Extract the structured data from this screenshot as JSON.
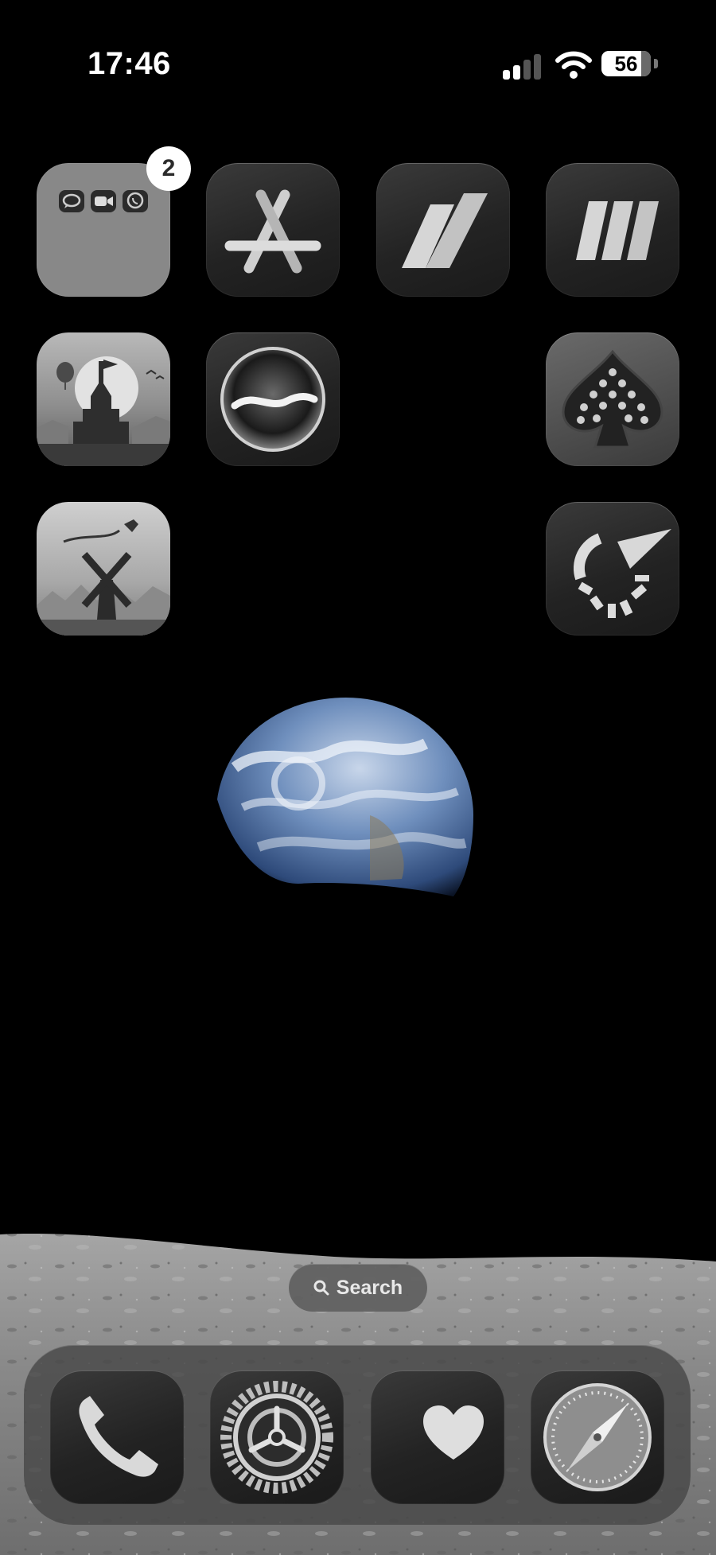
{
  "status_bar": {
    "time": "17:46",
    "signal_icon": "cellular-signal-icon",
    "wifi_icon": "wifi-icon",
    "battery_percent": "56"
  },
  "home_grid": {
    "folder": {
      "icon": "folder-icon",
      "badge": "2",
      "mini_apps": [
        "messages-icon",
        "facetime-icon",
        "viber-icon"
      ]
    },
    "apps": [
      {
        "name": "app-store",
        "icon": "app-store-icon"
      },
      {
        "name": "double-slash-app",
        "icon": "double-slash-icon"
      },
      {
        "name": "triple-slash-app",
        "icon": "triple-slash-icon"
      },
      {
        "name": "alto-castle-game",
        "icon": "castle-icon"
      },
      {
        "name": "siri-orb-app",
        "icon": "orb-icon"
      },
      {
        "name": "spade-cards-game",
        "icon": "spade-icon"
      },
      {
        "name": "alto-windmill-game",
        "icon": "windmill-icon"
      },
      {
        "name": "speedtest-app",
        "icon": "gauge-icon"
      }
    ]
  },
  "search": {
    "label": "Search",
    "icon": "search-icon"
  },
  "dock": {
    "apps": [
      {
        "name": "phone",
        "icon": "phone-icon"
      },
      {
        "name": "settings",
        "icon": "gear-icon"
      },
      {
        "name": "health",
        "icon": "heart-icon"
      },
      {
        "name": "safari",
        "icon": "compass-icon"
      }
    ]
  },
  "wallpaper": {
    "earth_icon": "earth-image",
    "moon_icon": "moon-surface-image"
  },
  "colors": {
    "background": "#000000",
    "icon_tint": "#d8d8d8",
    "badge": "#ffffff"
  }
}
